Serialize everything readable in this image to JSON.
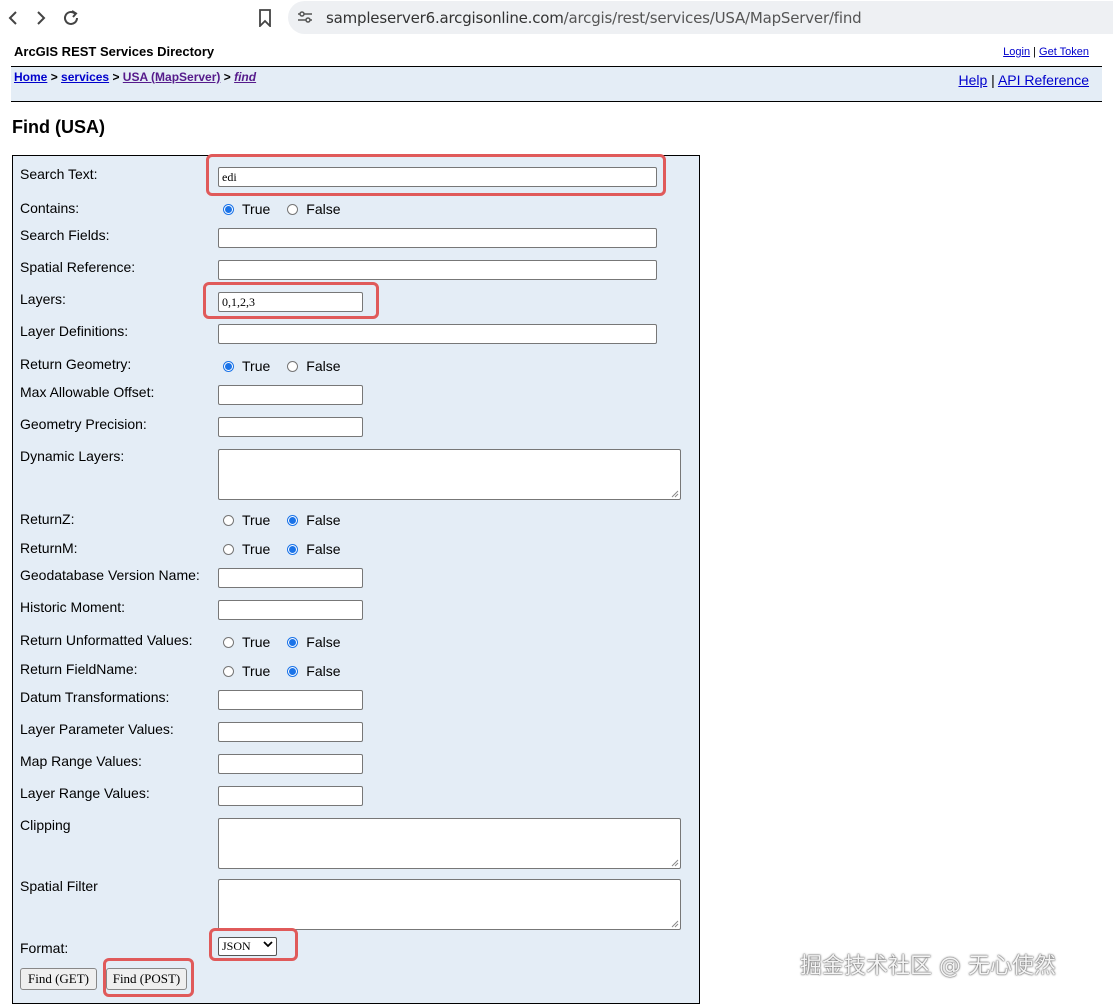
{
  "browser": {
    "url_host": "sampleserver6.arcgisonline.com",
    "url_path": "/arcgis/rest/services/USA/MapServer/find"
  },
  "header": {
    "directory_title": "ArcGIS REST Services Directory",
    "login": "Login",
    "separator": "|",
    "get_token": "Get Token"
  },
  "breadcrumb": {
    "home": "Home",
    "services": "services",
    "usa": "USA (MapServer)",
    "current": "find",
    "sep": ">"
  },
  "help_links": {
    "help": "Help",
    "separator": "|",
    "api_reference": "API Reference"
  },
  "page_title": "Find (USA)",
  "form": {
    "labels": {
      "search_text": "Search Text:",
      "contains": "Contains:",
      "search_fields": "Search Fields:",
      "spatial_reference": "Spatial Reference:",
      "layers": "Layers:",
      "layer_definitions": "Layer Definitions:",
      "return_geometry": "Return Geometry:",
      "max_allowable_offset": "Max Allowable Offset:",
      "geometry_precision": "Geometry Precision:",
      "dynamic_layers": "Dynamic Layers:",
      "return_z": "ReturnZ:",
      "return_m": "ReturnM:",
      "gdb_version": "Geodatabase Version Name:",
      "historic_moment": "Historic Moment:",
      "return_unformatted": "Return Unformatted Values:",
      "return_fieldname": "Return FieldName:",
      "datum_transformations": "Datum Transformations:",
      "layer_parameter_values": "Layer Parameter Values:",
      "map_range_values": "Map Range Values:",
      "layer_range_values": "Layer Range Values:",
      "clipping": "Clipping",
      "spatial_filter": "Spatial Filter",
      "format": "Format:"
    },
    "values": {
      "search_text": "edi",
      "layers": "0,1,2,3",
      "format": "JSON"
    },
    "radio_true": "True",
    "radio_false": "False",
    "selected": {
      "contains": "True",
      "return_geometry": "True",
      "return_z": "False",
      "return_m": "False",
      "return_unformatted": "False",
      "return_fieldname": "False"
    },
    "buttons": {
      "find_get": "Find (GET)",
      "find_post": "Find (POST)"
    }
  },
  "watermark": "掘金技术社区 @ 无心使然",
  "colors": {
    "highlight": "#e05a5a",
    "panel_bg": "#e4edf6",
    "link": "#0000cc",
    "radio_accent": "#1a73e8"
  }
}
